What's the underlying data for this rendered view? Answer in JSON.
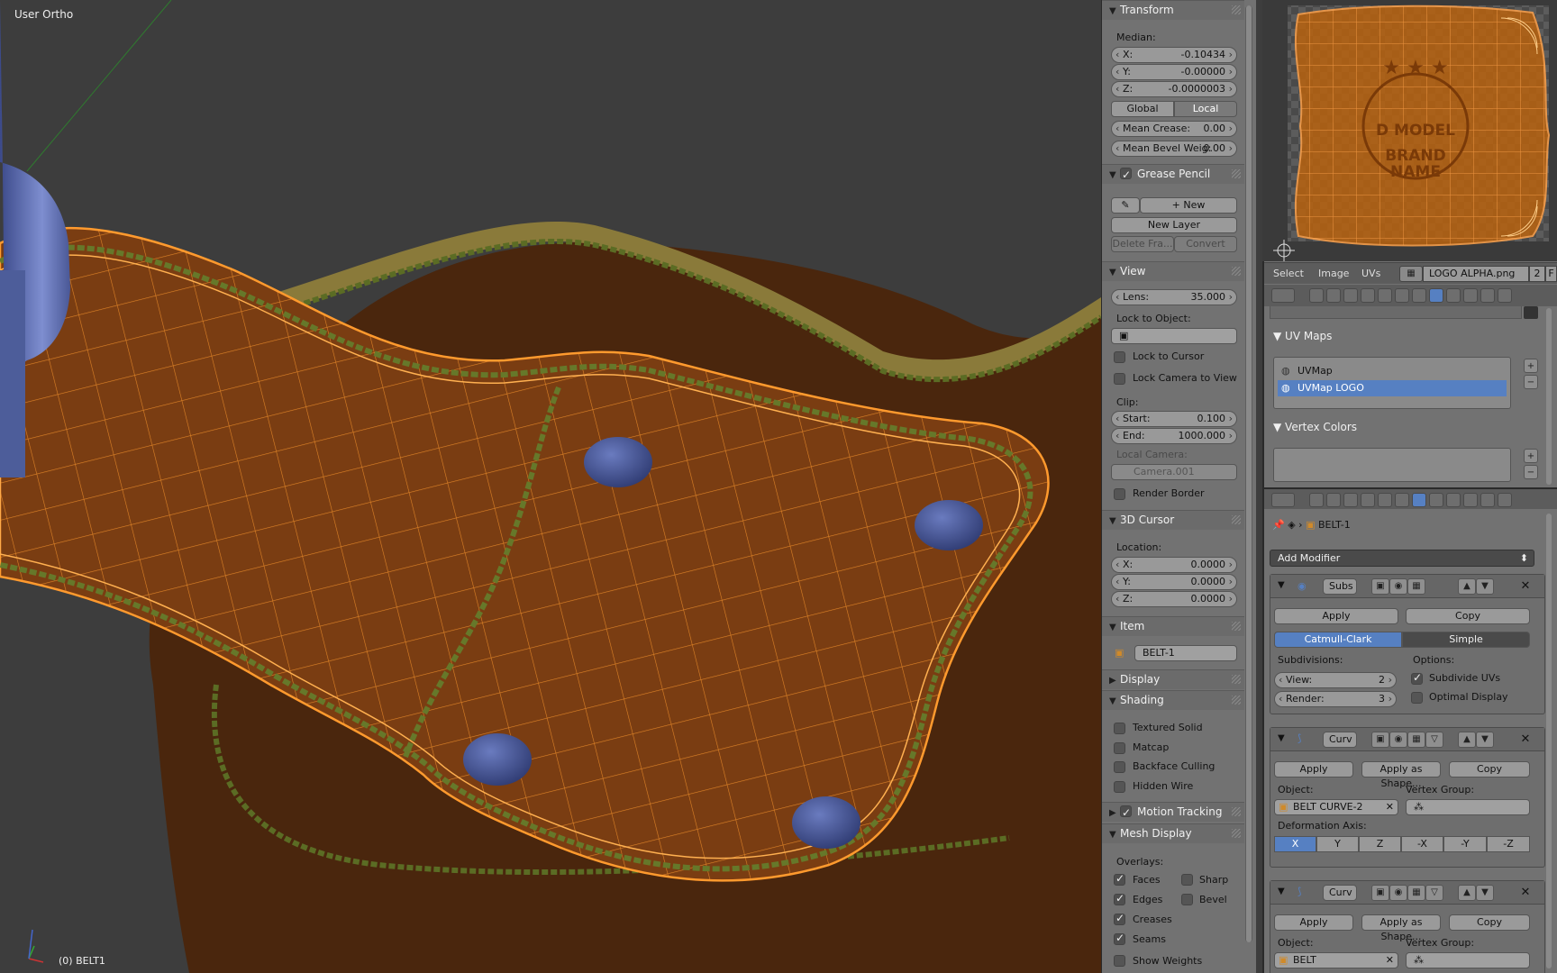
{
  "viewport": {
    "view_name": "User Ortho",
    "object_status": "(0) BELT1"
  },
  "npanel": {
    "transform": {
      "title": "Transform",
      "median_label": "Median:",
      "x": {
        "label": "X:",
        "value": "-0.10434"
      },
      "y": {
        "label": "Y:",
        "value": "-0.00000"
      },
      "z": {
        "label": "Z:",
        "value": "-0.0000003"
      },
      "global": "Global",
      "local": "Local",
      "mean_crease": {
        "label": "Mean Crease:",
        "value": "0.00"
      },
      "mean_bevel": {
        "label": "Mean Bevel Weig:",
        "value": "0.00"
      }
    },
    "grease_pencil": {
      "title": "Grease Pencil",
      "new": "New",
      "new_layer": "New Layer",
      "delete_frame": "Delete Fra...",
      "convert": "Convert"
    },
    "view": {
      "title": "View",
      "lens": {
        "label": "Lens:",
        "value": "35.000"
      },
      "lock_to_object": "Lock to Object:",
      "lock_to_cursor": "Lock to Cursor",
      "lock_camera": "Lock Camera to View",
      "clip": "Clip:",
      "start": {
        "label": "Start:",
        "value": "0.100"
      },
      "end": {
        "label": "End:",
        "value": "1000.000"
      },
      "local_camera": "Local Camera:",
      "camera": "Camera.001",
      "render_border": "Render Border"
    },
    "cursor": {
      "title": "3D Cursor",
      "location": "Location:",
      "x": {
        "label": "X:",
        "value": "0.0000"
      },
      "y": {
        "label": "Y:",
        "value": "0.0000"
      },
      "z": {
        "label": "Z:",
        "value": "0.0000"
      }
    },
    "item": {
      "title": "Item",
      "name": "BELT-1"
    },
    "display": {
      "title": "Display"
    },
    "shading": {
      "title": "Shading",
      "textured_solid": "Textured Solid",
      "matcap": "Matcap",
      "backface_culling": "Backface Culling",
      "hidden_wire": "Hidden Wire"
    },
    "motion_tracking": {
      "title": "Motion Tracking"
    },
    "mesh_display": {
      "title": "Mesh Display",
      "overlays": "Overlays:",
      "faces": "Faces",
      "sharp": "Sharp",
      "edges": "Edges",
      "bevel": "Bevel",
      "creases": "Creases",
      "seams": "Seams",
      "show_weights": "Show Weights"
    }
  },
  "uv_editor": {
    "logo_text": [
      "D MODEL",
      "BRAND",
      "NAME"
    ],
    "menu_select": "Select",
    "menu_image": "Image",
    "menu_uvs": "UVs",
    "image_name": "LOGO ALPHA.png",
    "users": "2",
    "fake": "F"
  },
  "properties": {
    "uv_maps": {
      "title": "UV Maps",
      "items": [
        "UVMap",
        "UVMap LOGO"
      ]
    },
    "vertex_colors": {
      "title": "Vertex Colors"
    },
    "object_name": "BELT-1",
    "add_modifier": "Add Modifier",
    "subsurf": {
      "name": "Subs",
      "apply": "Apply",
      "copy": "Copy",
      "catmull": "Catmull-Clark",
      "simple": "Simple",
      "subdivisions": "Subdivisions:",
      "options": "Options:",
      "view": {
        "label": "View:",
        "value": "2"
      },
      "render": {
        "label": "Render:",
        "value": "3"
      },
      "subdivide_uvs": "Subdivide UVs",
      "optimal_display": "Optimal Display"
    },
    "curve1": {
      "name": "Curv",
      "apply": "Apply",
      "apply_shape": "Apply as Shape...",
      "copy": "Copy",
      "object_label": "Object:",
      "object": "BELT CURVE-2",
      "vgroup_label": "Vertex Group:",
      "deform_axis": "Deformation Axis:",
      "axes": [
        "X",
        "Y",
        "Z",
        "-X",
        "-Y",
        "-Z"
      ]
    },
    "curve2": {
      "name": "Curv",
      "apply": "Apply",
      "apply_shape": "Apply as Shape...",
      "copy": "Copy",
      "object_label": "Object:",
      "object": "BELT",
      "vgroup_label": "Vertex Group:"
    }
  },
  "colors": {
    "leather": "#7a3d12",
    "wire": "#ff9a2e",
    "selection_blue": "#5680c2",
    "stitch": "#6b7a2a",
    "rivet": "#4d5d9a"
  }
}
